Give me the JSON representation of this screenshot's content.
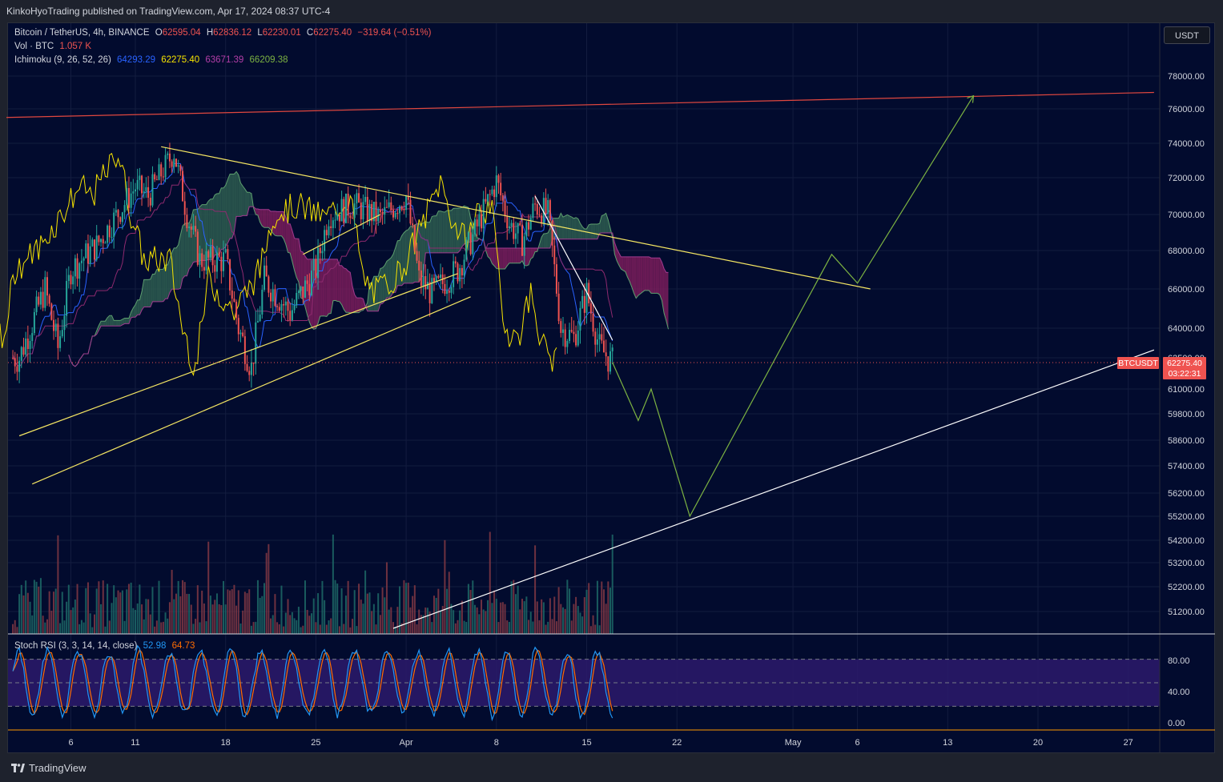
{
  "header": {
    "published": "KinkoHyoTrading published on TradingView.com, Apr 17, 2024 08:37 UTC-4"
  },
  "symbol": {
    "name": "Bitcoin / TetherUS, 4h, BINANCE",
    "o_label": "O",
    "o": "62595.04",
    "h_label": "H",
    "h": "62836.12",
    "l_label": "L",
    "l": "62230.01",
    "c_label": "C",
    "c": "62275.40",
    "change": "−319.64 (−0.51%)"
  },
  "volume": {
    "label": "Vol · BTC",
    "value": "1.057 K"
  },
  "ichimoku": {
    "label": "Ichimoku (9, 26, 52, 26)",
    "v1": "64293.29",
    "v2": "62275.40",
    "v3": "63671.39",
    "v4": "66209.38"
  },
  "stoch": {
    "label": "Stoch RSI (3, 3, 14, 14, close)",
    "k": "52.98",
    "d": "64.73"
  },
  "currency_button": "USDT",
  "price_tag": {
    "symbol": "BTCUSDT",
    "price": "62275.40",
    "countdown": "03:22:31"
  },
  "footer": {
    "brand": "TradingView"
  },
  "colors": {
    "background": "#020b2e",
    "up": "#26a69a",
    "down": "#ef5350",
    "tenkan": "#2962ff",
    "kijun": "#f7e400",
    "cloud_bear": "#7b1d5c",
    "cloud_bull": "#2e5e50",
    "stoch_k": "#2196f3",
    "stoch_d": "#ff6d00",
    "trend_yellow": "#f5e663",
    "trend_red": "#e0473f",
    "trend_white": "#ffffff",
    "projection": "#7cb342"
  },
  "chart_data": {
    "type": "candlestick",
    "title": "Bitcoin / TetherUS, 4h, BINANCE",
    "x_ticks": [
      "6",
      "11",
      "18",
      "25",
      "Apr",
      "8",
      "15",
      "22",
      "May",
      "6",
      "13",
      "20",
      "27"
    ],
    "y_ticks": [
      "78000.00",
      "76000.00",
      "74000.00",
      "72000.00",
      "70000.00",
      "68000.00",
      "66000.00",
      "64000.00",
      "62500.00",
      "61000.00",
      "59800.00",
      "58600.00",
      "57400.00",
      "56200.00",
      "55200.00",
      "54200.00",
      "53200.00",
      "52200.00",
      "51200.00"
    ],
    "stoch_ticks": [
      "80.00",
      "40.00",
      "0.00"
    ],
    "last_price": 62275.4,
    "price_path": [
      [
        "Mar 2",
        62500
      ],
      [
        "Mar 4",
        66000
      ],
      [
        "Mar 5",
        63000
      ],
      [
        "Mar 6",
        67000
      ],
      [
        "Mar 8",
        68300
      ],
      [
        "Mar 11",
        71500
      ],
      [
        "Mar 12",
        71000
      ],
      [
        "Mar 14",
        73500
      ],
      [
        "Mar 15",
        70000
      ],
      [
        "Mar 16",
        67500
      ],
      [
        "Mar 18",
        67500
      ],
      [
        "Mar 19",
        64000
      ],
      [
        "Mar 20",
        62000
      ],
      [
        "Mar 21",
        66500
      ],
      [
        "Mar 23",
        64800
      ],
      [
        "Mar 25",
        67000
      ],
      [
        "Mar 26",
        70000
      ],
      [
        "Mar 28",
        70500
      ],
      [
        "Mar 30",
        69800
      ],
      [
        "Apr 1",
        71000
      ],
      [
        "Apr 2",
        66500
      ],
      [
        "Apr 3",
        65800
      ],
      [
        "Apr 5",
        67000
      ],
      [
        "Apr 6",
        68500
      ],
      [
        "Apr 8",
        71800
      ],
      [
        "Apr 9",
        69500
      ],
      [
        "Apr 10",
        68500
      ],
      [
        "Apr 11",
        70500
      ],
      [
        "Apr 12",
        70000
      ],
      [
        "Apr 13",
        64000
      ],
      [
        "Apr 14",
        63500
      ],
      [
        "Apr 15",
        65800
      ],
      [
        "Apr 16",
        63000
      ],
      [
        "Apr 17",
        62275.4
      ]
    ],
    "projection_path": [
      [
        "Apr 17",
        62275
      ],
      [
        "Apr 19",
        59500
      ],
      [
        "Apr 20",
        61000
      ],
      [
        "Apr 23",
        55200
      ],
      [
        "May 4",
        67800
      ],
      [
        "May 6",
        66300
      ],
      [
        "May 15",
        76800
      ]
    ],
    "trend_lines": [
      {
        "color": "red",
        "from": [
          "Mar 1",
          75500
        ],
        "to": [
          "May 29",
          77000
        ]
      },
      {
        "color": "yellow",
        "from": [
          "Mar 13",
          73800
        ],
        "to": [
          "May 7",
          66000
        ]
      },
      {
        "color": "yellow",
        "from": [
          "Mar 2",
          58800
        ],
        "to": [
          "Apr 5",
          66800
        ]
      },
      {
        "color": "yellow",
        "from": [
          "Mar 3",
          56600
        ],
        "to": [
          "Apr 6",
          65600
        ]
      },
      {
        "color": "yellow",
        "from": [
          "Mar 24",
          67800
        ],
        "to": [
          "Mar 30",
          70000
        ]
      },
      {
        "color": "white",
        "from": [
          "Mar 31",
          50300
        ],
        "to": [
          "May 29",
          62900
        ]
      },
      {
        "color": "white",
        "from": [
          "Apr 11",
          71000
        ],
        "to": [
          "Apr 17",
          63400
        ]
      }
    ],
    "stoch_range": [
      0,
      100
    ],
    "stoch_band": [
      20,
      80
    ]
  }
}
